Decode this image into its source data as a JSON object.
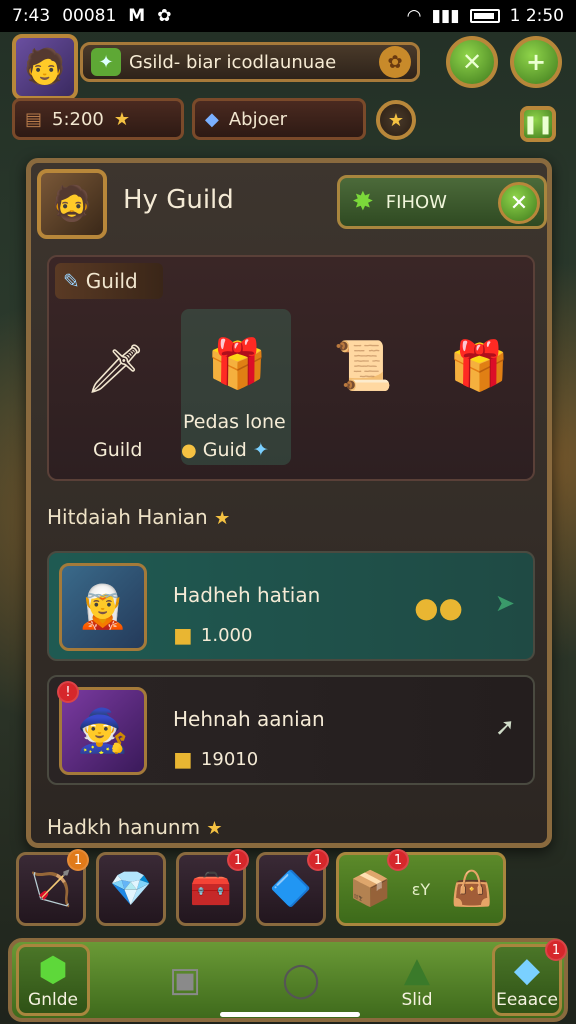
{
  "status_bar": {
    "time_left": "7:43",
    "carrier": "00081",
    "notif_icon": "M",
    "time_right": "1 2:50"
  },
  "header": {
    "guild_name": "Gsild- biar icodlaunuae",
    "currency": {
      "gold": "5:200",
      "gem_label": "Abjoer"
    }
  },
  "panel": {
    "title": "Hy Guild",
    "follow_label": "FIHOW",
    "guild_tag": "Guild",
    "items": [
      {
        "label": "Guild",
        "icon": "spear-icon"
      },
      {
        "label": "Pedas lone",
        "sub_label": "Guid",
        "icon": "crystal-chest-icon"
      },
      {
        "label": "",
        "icon": "scroll-icon"
      },
      {
        "label": "",
        "icon": "gift-box-icon"
      }
    ],
    "section_1": "Hitdaiah Hanian",
    "tasks": [
      {
        "name": "Hadheh hatian",
        "reward": "1.000"
      },
      {
        "name": "Hehnah aanian",
        "reward": "19010"
      }
    ],
    "section_2": "Hadkh hanunm"
  },
  "inventory": [
    {
      "icon": "arrow-icon",
      "badge": "1"
    },
    {
      "icon": "crystal-icon",
      "badge": ""
    },
    {
      "icon": "chest-icon",
      "badge": "1"
    },
    {
      "icon": "crystal-blue-icon",
      "badge": "1"
    }
  ],
  "inventory_green": {
    "badge": "1",
    "label": "ɛY"
  },
  "nav": [
    {
      "label": "Gnlde",
      "icon": "gem-green-icon"
    },
    {
      "label": "",
      "icon": "device-icon"
    },
    {
      "label": "",
      "icon": "ring-icon"
    },
    {
      "label": "Slid",
      "icon": "slide-icon"
    },
    {
      "label": "Eeaace",
      "icon": "cube-icon",
      "badge": "1"
    }
  ],
  "colors": {
    "accent_gold": "#b8873a",
    "accent_green": "#6a9a36",
    "badge_red": "#d6272b"
  }
}
